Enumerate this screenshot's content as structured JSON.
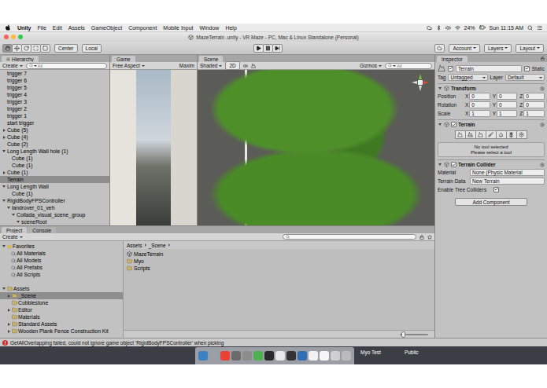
{
  "menubar": {
    "app": "Unity",
    "items": [
      "File",
      "Edit",
      "Assets",
      "GameObject",
      "Component",
      "Mobile Input",
      "Window",
      "Help"
    ],
    "battery": "24%",
    "clock": "Sun 11:15 AM"
  },
  "window": {
    "title": "MazeTerrain .unity - VR Maze - PC, Mac & Linux Standalone (Personal)"
  },
  "toolbar": {
    "tools": [
      {
        "selected": true
      },
      {
        "selected": false
      },
      {
        "selected": false
      },
      {
        "selected": false
      },
      {
        "selected": false
      }
    ],
    "pivot": "Center",
    "space": "Local",
    "playback": [
      {
        "selected": false
      },
      {
        "selected": false
      },
      {
        "selected": false
      }
    ],
    "account": "Account",
    "layers": "Layers",
    "layout": "Layout"
  },
  "hierarchy": {
    "title": "Hierarchy",
    "create": "Create",
    "search": "All",
    "items": [
      {
        "label": "trigger 7",
        "depth": 0,
        "kind": "leaf",
        "expanded": false,
        "selected": false
      },
      {
        "label": "trigger 6",
        "depth": 0,
        "kind": "leaf",
        "expanded": false,
        "selected": false
      },
      {
        "label": "trigger 5",
        "depth": 0,
        "kind": "leaf",
        "expanded": false,
        "selected": false
      },
      {
        "label": "trigger 4",
        "depth": 0,
        "kind": "leaf",
        "expanded": false,
        "selected": false
      },
      {
        "label": "trigger 3",
        "depth": 0,
        "kind": "leaf",
        "expanded": false,
        "selected": false
      },
      {
        "label": "trigger 2",
        "depth": 0,
        "kind": "leaf",
        "expanded": false,
        "selected": false
      },
      {
        "label": "trigger 1",
        "depth": 0,
        "kind": "leaf",
        "expanded": false,
        "selected": false
      },
      {
        "label": "start trigger",
        "depth": 0,
        "kind": "leaf",
        "expanded": false,
        "selected": false
      },
      {
        "label": "Cube (5)",
        "depth": 0,
        "kind": "group",
        "expanded": false,
        "selected": false
      },
      {
        "label": "Cube (4)",
        "depth": 0,
        "kind": "group",
        "expanded": false,
        "selected": false
      },
      {
        "label": "Cube (2)",
        "depth": 0,
        "kind": "leaf",
        "expanded": false,
        "selected": false
      },
      {
        "label": "Long Length Wall hole (1)",
        "depth": 0,
        "kind": "group",
        "expanded": true,
        "selected": false
      },
      {
        "label": "Cube (1)",
        "depth": 1,
        "kind": "leaf",
        "expanded": false,
        "selected": false
      },
      {
        "label": "Cube (1)",
        "depth": 1,
        "kind": "leaf",
        "expanded": false,
        "selected": false
      },
      {
        "label": "Cube (1)",
        "depth": 0,
        "kind": "group",
        "expanded": false,
        "selected": false
      },
      {
        "label": "Terrain",
        "depth": 0,
        "kind": "leaf",
        "expanded": false,
        "selected": true
      },
      {
        "label": "Long Length Wall",
        "depth": 0,
        "kind": "group",
        "expanded": true,
        "selected": false
      },
      {
        "label": "Cube (1)",
        "depth": 1,
        "kind": "leaf",
        "expanded": false,
        "selected": false
      },
      {
        "label": "RigidBodyFPSController",
        "depth": 0,
        "kind": "group",
        "expanded": true,
        "selected": false
      },
      {
        "label": "landrover_01_veh",
        "depth": 1,
        "kind": "group",
        "expanded": true,
        "selected": false
      },
      {
        "label": "Collada_visual_scene_group",
        "depth": 2,
        "kind": "group",
        "expanded": true,
        "selected": false
      },
      {
        "label": "sceneRoot",
        "depth": 3,
        "kind": "group",
        "expanded": true,
        "selected": false
      }
    ]
  },
  "game": {
    "title": "Game",
    "aspect": "Free Aspect",
    "maximize": "Maxim"
  },
  "scene": {
    "title": "Scene",
    "shading": "Shaded",
    "mode_2d": "2D",
    "gizmos": "Gizmos",
    "search": "All"
  },
  "inspector": {
    "title": "Inspector",
    "object": {
      "name": "Terrain",
      "active": true,
      "static_label": "Static",
      "static": true
    },
    "tag": {
      "label": "Tag",
      "value": "Untagged"
    },
    "layer": {
      "label": "Layer",
      "value": "Default"
    },
    "components": [
      {
        "kind": "transform",
        "title": "Transform",
        "rows": [
          {
            "label": "Position",
            "values": [
              {
                "axis": "X",
                "value": "0"
              },
              {
                "axis": "Y",
                "value": "0"
              },
              {
                "axis": "Z",
                "value": "0"
              }
            ]
          },
          {
            "label": "Rotation",
            "values": [
              {
                "axis": "X",
                "value": "0"
              },
              {
                "axis": "Y",
                "value": "0"
              },
              {
                "axis": "Z",
                "value": "0"
              }
            ]
          },
          {
            "label": "Scale",
            "values": [
              {
                "axis": "X",
                "value": "1"
              },
              {
                "axis": "Y",
                "value": "1"
              },
              {
                "axis": "Z",
                "value": "1"
              }
            ]
          }
        ]
      },
      {
        "kind": "terrain",
        "title": "Terrain",
        "enabled": true,
        "tools": [
          {
            "selected": false
          },
          {
            "selected": false
          },
          {
            "selected": false
          },
          {
            "selected": false
          },
          {
            "selected": false
          },
          {
            "selected": false
          },
          {
            "selected": false
          }
        ],
        "message": [
          "No tool selected",
          "Please select a tool"
        ]
      },
      {
        "kind": "collider",
        "title": "Terrain Collider",
        "enabled": true,
        "fields": [
          {
            "label": "Material",
            "value": "None (Physic Material"
          },
          {
            "label": "Terrain Data",
            "value": "New Terrain"
          }
        ],
        "checkbox": {
          "label": "Enable Tree Colliders",
          "checked": true
        }
      }
    ],
    "add_component": "Add Component"
  },
  "project": {
    "tabs": [
      {
        "label": "Project",
        "selected": true
      },
      {
        "label": "Console",
        "selected": false
      }
    ],
    "create": "Create",
    "favorites": {
      "label": "Favorites",
      "expanded": true,
      "items": [
        "All Materials",
        "All Models",
        "All Prefabs",
        "All Scripts"
      ]
    },
    "assets": {
      "label": "Assets",
      "expanded": true,
      "items": [
        {
          "label": "_Scene",
          "kind": "group",
          "expanded": false,
          "selected": true
        },
        {
          "label": "Cobblestone",
          "kind": "leaf",
          "expanded": false,
          "selected": false
        },
        {
          "label": "Editor",
          "kind": "group",
          "expanded": false,
          "selected": false
        },
        {
          "label": "Materials",
          "kind": "leaf",
          "expanded": false,
          "selected": false
        },
        {
          "label": "Standard Assets",
          "kind": "group",
          "expanded": false,
          "selected": false
        },
        {
          "label": "Wooden Plank Fence Construction Kit",
          "kind": "group",
          "expanded": false,
          "selected": false
        }
      ]
    },
    "breadcrumb": [
      "Assets",
      "_Scene"
    ],
    "files": [
      {
        "label": "MazeTerrain",
        "kind": "scene"
      },
      {
        "label": "Myo",
        "kind": "folder"
      },
      {
        "label": "Scripts",
        "kind": "folder"
      }
    ],
    "icon_size": {
      "level": 0.05
    }
  },
  "status_bar": {
    "error": "GetAllOverlapping failed, could not ignore game object 'RigidBodyFPSController' when picking"
  },
  "desktop": {
    "labels": [
      "Myo Test",
      "Public"
    ]
  }
}
